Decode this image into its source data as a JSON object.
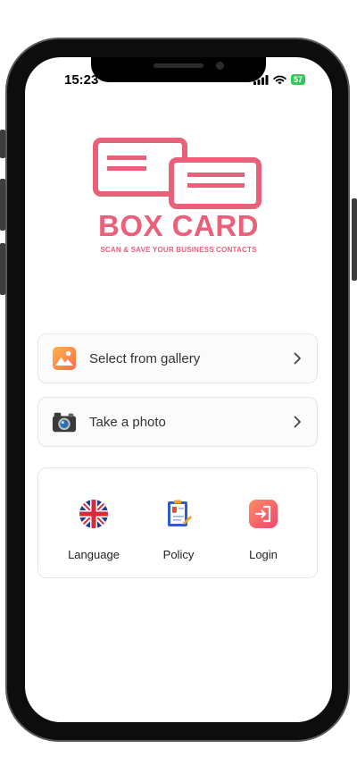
{
  "status_bar": {
    "time": "15:23",
    "battery": "57"
  },
  "app": {
    "name": "BOX CARD",
    "tagline": "SCAN & SAVE YOUR BUSINESS CONTACTS"
  },
  "actions": [
    {
      "label": "Select from gallery",
      "icon": "gallery-icon"
    },
    {
      "label": "Take a photo",
      "icon": "camera-icon"
    }
  ],
  "shortcuts": [
    {
      "label": "Language",
      "icon": "uk-flag-icon"
    },
    {
      "label": "Policy",
      "icon": "policy-document-icon"
    },
    {
      "label": "Login",
      "icon": "login-icon"
    }
  ],
  "colors": {
    "brand": "#e9607a",
    "battery": "#34c759"
  }
}
